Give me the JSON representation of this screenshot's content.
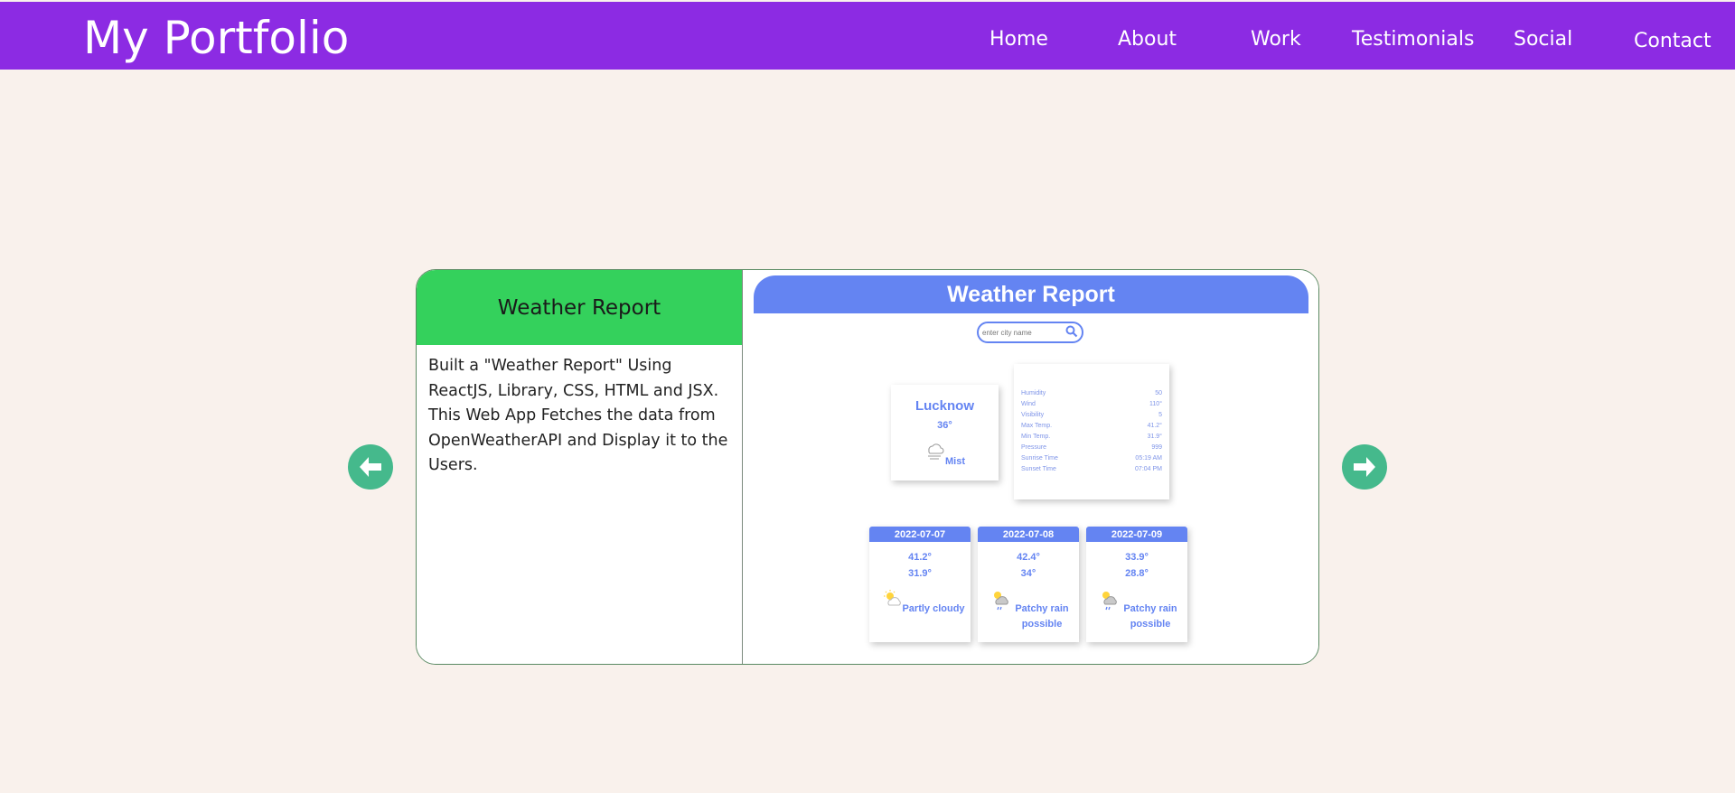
{
  "nav": {
    "brand": "My Portfolio",
    "links": [
      "Home",
      "About",
      "Work",
      "Testimonials",
      "Social",
      "Contact"
    ]
  },
  "project": {
    "title": "Weather Report",
    "description": "Built a \"Weather Report\" Using ReactJS, Library, CSS, HTML and JSX. This Web App Fetches the data from OpenWeatherAPI and Display it to the Users."
  },
  "screenshot": {
    "header": "Weather Report",
    "search_placeholder": "enter city name",
    "city": "Lucknow",
    "temp": "36°",
    "condition": "Mist",
    "stats": [
      {
        "label": "Humidity",
        "value": "50"
      },
      {
        "label": "Wind",
        "value": "110°"
      },
      {
        "label": "Visibility",
        "value": "5"
      },
      {
        "label": "Max Temp.",
        "value": "41.2°"
      },
      {
        "label": "Min Temp.",
        "value": "31.9°"
      },
      {
        "label": "Pressure",
        "value": "999"
      },
      {
        "label": "Sunrise Time",
        "value": "05:19 AM"
      },
      {
        "label": "Sunset Time",
        "value": "07:04 PM"
      }
    ],
    "forecast": [
      {
        "date": "2022-07-07",
        "max": "41.2°",
        "min": "31.9°",
        "cond_line1": "Partly cloudy",
        "cond_line2": ""
      },
      {
        "date": "2022-07-08",
        "max": "42.4°",
        "min": "34°",
        "cond_line1": "Patchy rain",
        "cond_line2": "possible"
      },
      {
        "date": "2022-07-09",
        "max": "33.9°",
        "min": "28.8°",
        "cond_line1": "Patchy rain",
        "cond_line2": "possible"
      }
    ]
  },
  "colors": {
    "navbar": "#8c2be3",
    "page_bg": "#f9f1ec",
    "card_title_bg": "#34d15c",
    "arrow": "#45b98c",
    "weather_accent": "#6484f2"
  },
  "icons": {
    "prev": "arrow-left-icon",
    "next": "arrow-right-icon",
    "search": "search-icon",
    "mist": "mist-icon",
    "partly_cloudy": "partly-cloudy-icon",
    "rain": "patchy-rain-icon"
  }
}
